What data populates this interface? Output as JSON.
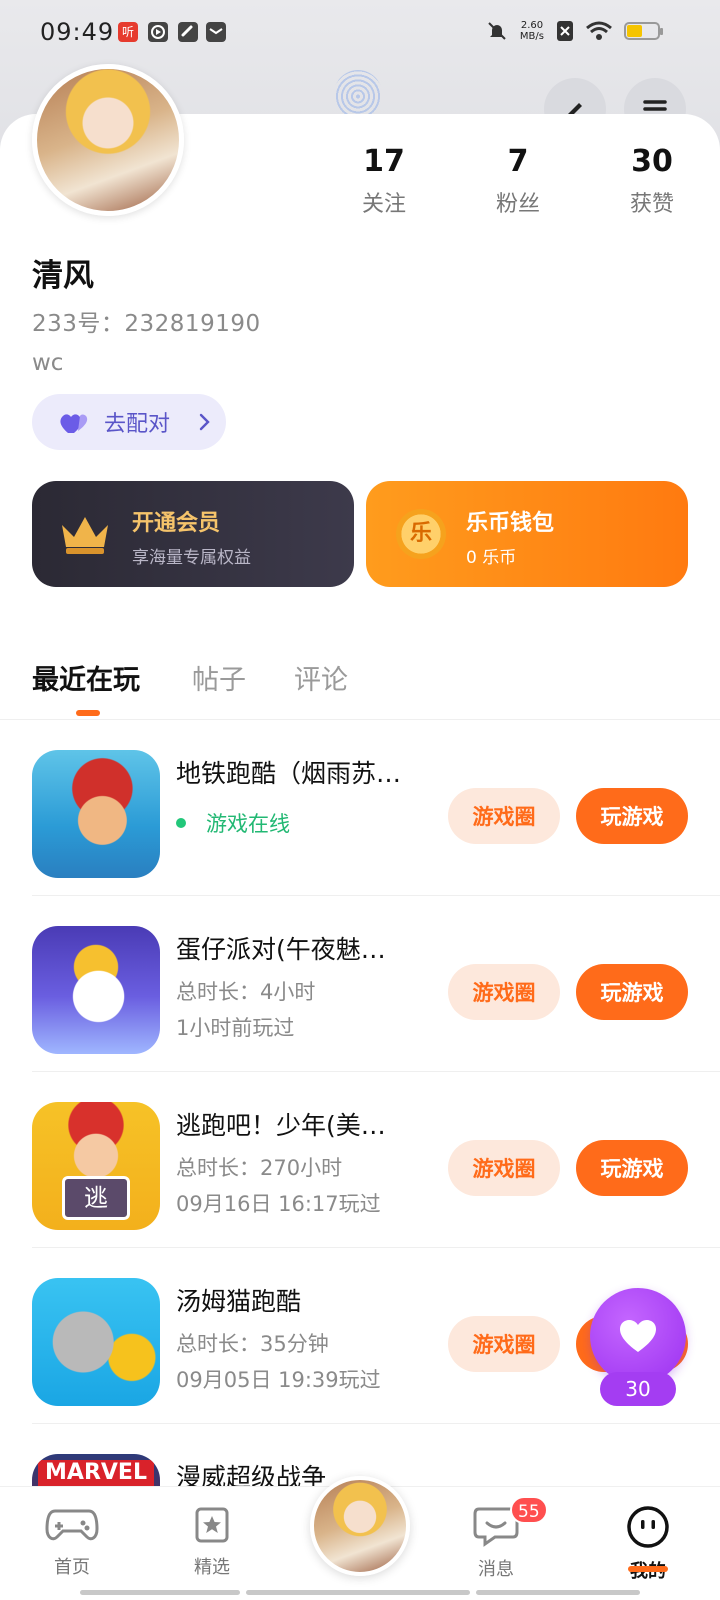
{
  "status_bar": {
    "time": "09:49",
    "net_speed_value": "2.60",
    "net_speed_unit": "MB/s",
    "battery_level": 0.5,
    "battery_color": "#f5c400",
    "icons": [
      "news-app-icon",
      "play-app-icon",
      "link-app-icon",
      "mail-app-icon",
      "mute-icon",
      "sim-off-icon",
      "wifi-icon"
    ]
  },
  "header": {
    "edit_icon": "edit-pencil-icon",
    "menu_icon": "hamburger-menu-icon"
  },
  "profile": {
    "name": "清风",
    "id_text": "233号：232819190",
    "bio": "wc",
    "stats": [
      {
        "value": "17",
        "label": "关注"
      },
      {
        "value": "7",
        "label": "粉丝"
      },
      {
        "value": "30",
        "label": "获赞"
      }
    ],
    "match_button": "去配对"
  },
  "promos": {
    "vip": {
      "title": "开通会员",
      "subtitle": "享海量专属权益"
    },
    "wallet": {
      "title": "乐币钱包",
      "subtitle": "0 乐币",
      "coin_char": "乐"
    }
  },
  "tabs": [
    {
      "label": "最近在玩",
      "active": true
    },
    {
      "label": "帖子",
      "active": false
    },
    {
      "label": "评论",
      "active": false
    }
  ],
  "games": [
    {
      "title": "地铁跑酷（烟雨苏…",
      "line1": "游戏在线",
      "line2": "",
      "online": true,
      "circle_label": "游戏圈",
      "play_label": "玩游戏"
    },
    {
      "title": "蛋仔派对(午夜魅…",
      "line1": "总时长：4小时",
      "line2": "1小时前玩过",
      "online": false,
      "circle_label": "游戏圈",
      "play_label": "玩游戏"
    },
    {
      "title": "逃跑吧！少年(美…",
      "line1": "总时长：270小时",
      "line2": "09月16日 16:17玩过",
      "online": false,
      "circle_label": "游戏圈",
      "play_label": "玩游戏"
    },
    {
      "title": "汤姆猫跑酷",
      "line1": "总时长：35分钟",
      "line2": "09月05日 19:39玩过",
      "online": false,
      "circle_label": "游戏圈",
      "play_label": "玩游戏"
    },
    {
      "title": "漫威超级战争",
      "line1": "",
      "line2": "",
      "online": false,
      "icon_text": "MARVEL"
    }
  ],
  "floating_like": {
    "count": "30"
  },
  "bottom_nav": {
    "items": [
      {
        "label": "首页",
        "icon": "gamepad-icon"
      },
      {
        "label": "精选",
        "icon": "star-bookmark-icon"
      },
      {
        "label": "消息",
        "icon": "chat-bubble-icon",
        "badge": "55"
      },
      {
        "label": "我的",
        "icon": "smiley-face-icon",
        "active": true
      }
    ]
  },
  "colors": {
    "accent": "#ff6b1a",
    "accent_light": "#fde8dc",
    "online_green": "#22b873",
    "like_purple": "#a43df2",
    "vip_dark": "#2b2934",
    "wallet_orange": "#ff8a14"
  }
}
